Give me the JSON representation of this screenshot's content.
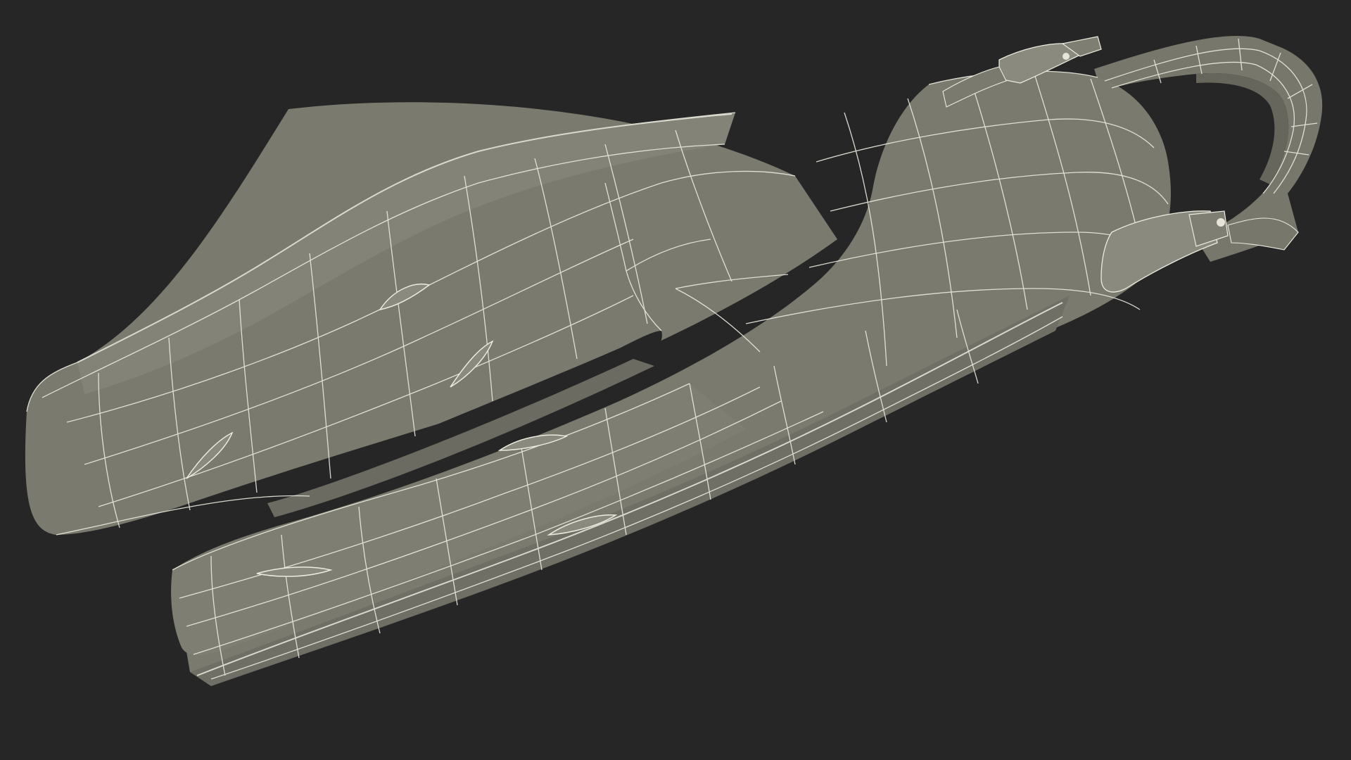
{
  "render": {
    "background_color": "#262626",
    "surface_color": "#7a7a6f",
    "surface_shadow_color": "#636359",
    "wire_color": "#ecebe0",
    "edge_highlight_color": "#d9d8cc",
    "slot_color": "#262626"
  },
  "objects": [
    {
      "name": "split-fin",
      "description_visible": false
    },
    {
      "name": "heel-strap",
      "description_visible": false
    },
    {
      "name": "strap-buckle-upper",
      "description_visible": false
    },
    {
      "name": "strap-buckle-lower",
      "description_visible": false
    }
  ]
}
